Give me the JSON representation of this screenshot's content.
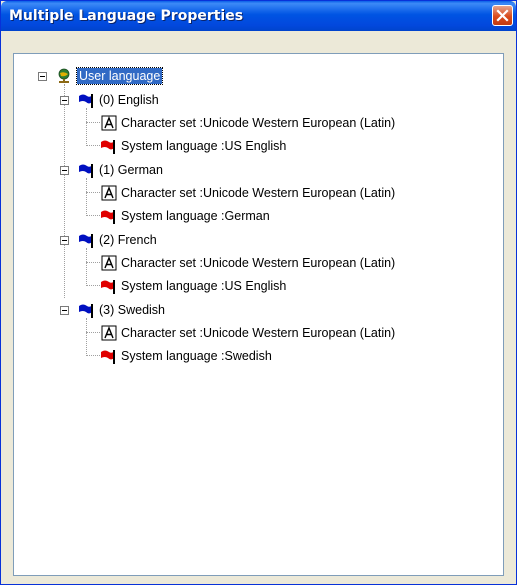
{
  "window": {
    "title": "Multiple Language Properties"
  },
  "tree": {
    "root_label": "User language",
    "languages": [
      {
        "label": "(0) English",
        "charset": "Character set :Unicode Western European (Latin)",
        "system": "System language :US English"
      },
      {
        "label": "(1) German",
        "charset": "Character set :Unicode Western European (Latin)",
        "system": "System language :German"
      },
      {
        "label": "(2) French",
        "charset": "Character set :Unicode Western European (Latin)",
        "system": "System language :US English"
      },
      {
        "label": "(3) Swedish",
        "charset": "Character set :Unicode Western European (Latin)",
        "system": "System language :Swedish"
      }
    ]
  },
  "colors": {
    "title_bar": "#0054E3",
    "selection": "#316AC5",
    "flag_blue": "#0010C0",
    "flag_red": "#E00000",
    "close": "#D94B1C"
  },
  "icons": {
    "root": "globe-user-icon",
    "language": "blue-flag-icon",
    "charset": "font-a-icon",
    "system": "red-flag-icon"
  }
}
